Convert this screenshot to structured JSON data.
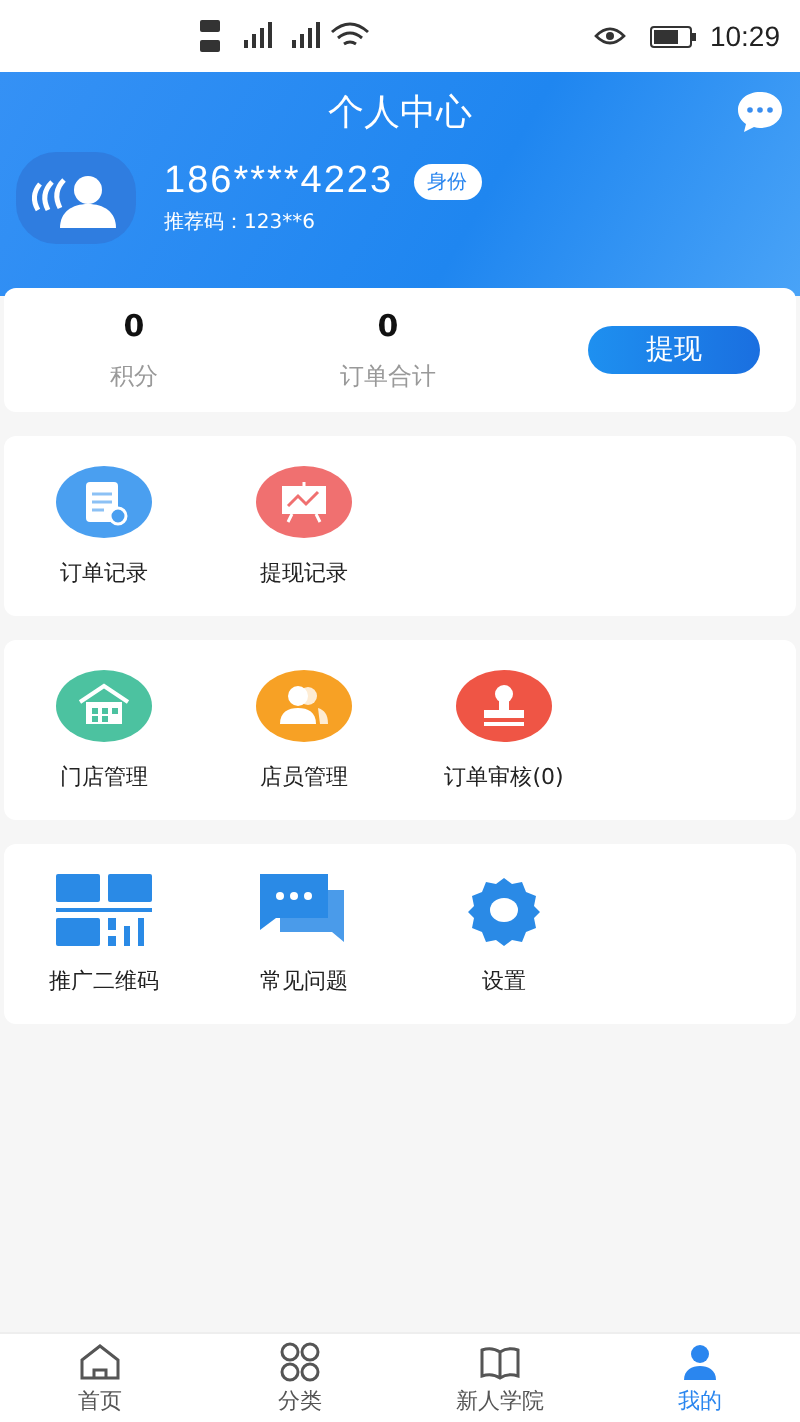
{
  "status_bar": {
    "time": "10:29"
  },
  "header": {
    "title": "个人中心",
    "phone": "186****4223",
    "badge": "身份",
    "referral": "推荐码：123**6"
  },
  "stats": [
    {
      "value": "0",
      "label": "积分"
    },
    {
      "value": "0",
      "label": "订单合计"
    }
  ],
  "withdraw_button": "提现",
  "sections": [
    [
      {
        "label": "订单记录",
        "kind": "order",
        "color": "#4a9ff0"
      },
      {
        "label": "提现记录",
        "kind": "chart",
        "color": "#f07070"
      }
    ],
    [
      {
        "label": "门店管理",
        "kind": "store",
        "color": "#4cc2a0"
      },
      {
        "label": "店员管理",
        "kind": "staff",
        "color": "#f7a125"
      },
      {
        "label": "订单审核(0)",
        "kind": "stamp",
        "color": "#ef5545"
      }
    ],
    [
      {
        "label": "推广二维码",
        "kind": "qr",
        "color": "#2a8ae6"
      },
      {
        "label": "常见问题",
        "kind": "faq",
        "color": "#2a8ae6"
      },
      {
        "label": "设置",
        "kind": "gear",
        "color": "#2a8ae6"
      }
    ]
  ],
  "nav": [
    {
      "label": "首页",
      "kind": "home",
      "selected": false
    },
    {
      "label": "分类",
      "kind": "category",
      "selected": false
    },
    {
      "label": "新人学院",
      "kind": "school",
      "selected": false
    },
    {
      "label": "我的",
      "kind": "user",
      "selected": true
    }
  ]
}
